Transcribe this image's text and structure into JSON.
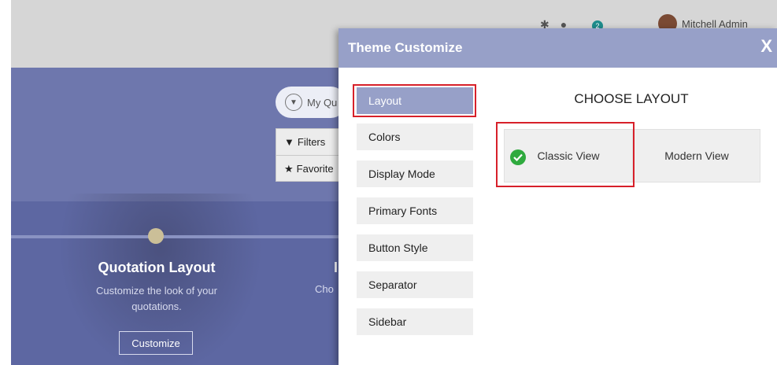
{
  "background": {
    "header": {
      "user_name": "Mitchell Admin",
      "notification_count": "2"
    },
    "search": {
      "placeholder": "My Qu"
    },
    "dropdown": {
      "filters_label": "Filters",
      "favorites_label": "Favorite"
    },
    "onboarding": {
      "title": "Quotation Layout",
      "description_line1": "Customize the look of your",
      "description_line2": "quotations.",
      "button_label": "Customize",
      "next_title_fragment": "I",
      "next_desc_fragment": "Cho"
    }
  },
  "modal": {
    "title": "Theme Customize",
    "close_label": "X",
    "nav_items": [
      {
        "label": "Layout",
        "active": true
      },
      {
        "label": "Colors",
        "active": false
      },
      {
        "label": "Display Mode",
        "active": false
      },
      {
        "label": "Primary Fonts",
        "active": false
      },
      {
        "label": "Button Style",
        "active": false
      },
      {
        "label": "Separator",
        "active": false
      },
      {
        "label": "Sidebar",
        "active": false
      }
    ],
    "section_title": "CHOOSE LAYOUT",
    "layout_options": [
      {
        "label": "Classic View",
        "selected": true
      },
      {
        "label": "Modern View",
        "selected": false
      }
    ]
  },
  "colors": {
    "modal_header": "#97a0c8",
    "highlight": "#d7202a",
    "check": "#2faa3e",
    "hero": "#6e77ad"
  },
  "icons": [
    "gear-icon",
    "chat-icon",
    "clock-icon",
    "funnel-icon",
    "filter-icon",
    "star-icon",
    "check-circle-icon"
  ]
}
